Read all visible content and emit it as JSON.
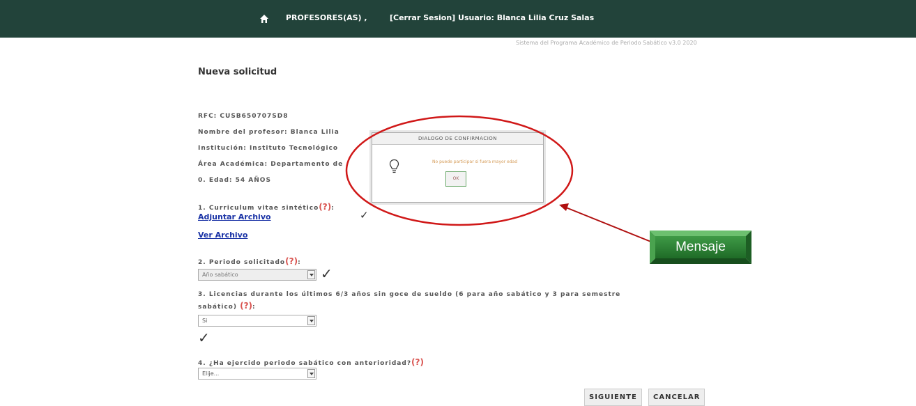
{
  "nav": {
    "menu_label": "PROFESORES(AS) ,",
    "user_label": "[Cerrar Sesion] Usuario: Blanca Lilia Cruz Salas",
    "bar_color": "#22433a"
  },
  "system_version": "Sistema del Programa Académico de Periodo Sabático v3.0 2020",
  "page_title": "Nueva solicitud",
  "info": {
    "rfc": "RFC: CUSB650707SD8",
    "professor": "Nombre del profesor: Blanca Lilia",
    "institution": "Institución: Instituto Tecnológico",
    "area": "Área Académica: Departamento de",
    "age": "0. Edad: 54 AÑOS"
  },
  "help_marker": "(?)",
  "q1": {
    "label": "1. Curriculum vitae sintético",
    "suffix": ":",
    "attach_link": "Adjuntar Archivo",
    "view_link": "Ver Archivo"
  },
  "q2": {
    "label": "2. Periodo solicitado",
    "suffix": ":",
    "selected": "Año sabático"
  },
  "q3": {
    "label_line1": "3. Licencias durante los últimos 6/3 años sin goce de sueldo (6 para año sabático y 3 para semestre",
    "label_line2": "sabático)",
    "suffix": ":",
    "selected": "Si"
  },
  "q4": {
    "label": "4. ¿Ha ejercido periodo sabático con anterioridad?",
    "selected": "Elije..."
  },
  "check_mark": "✓",
  "buttons": {
    "next": "SIGUIENTE",
    "cancel": "CANCELAR"
  },
  "dialog": {
    "title": "DIALOGO DE CONFIRMACION",
    "message": "No puede participar si fuera mayor edad",
    "ok": "OK",
    "icon": "lightbulb-icon"
  },
  "callout": {
    "label": "Mensaje",
    "fill_color": "#2e7d32",
    "ellipse_color": "#d01818"
  }
}
